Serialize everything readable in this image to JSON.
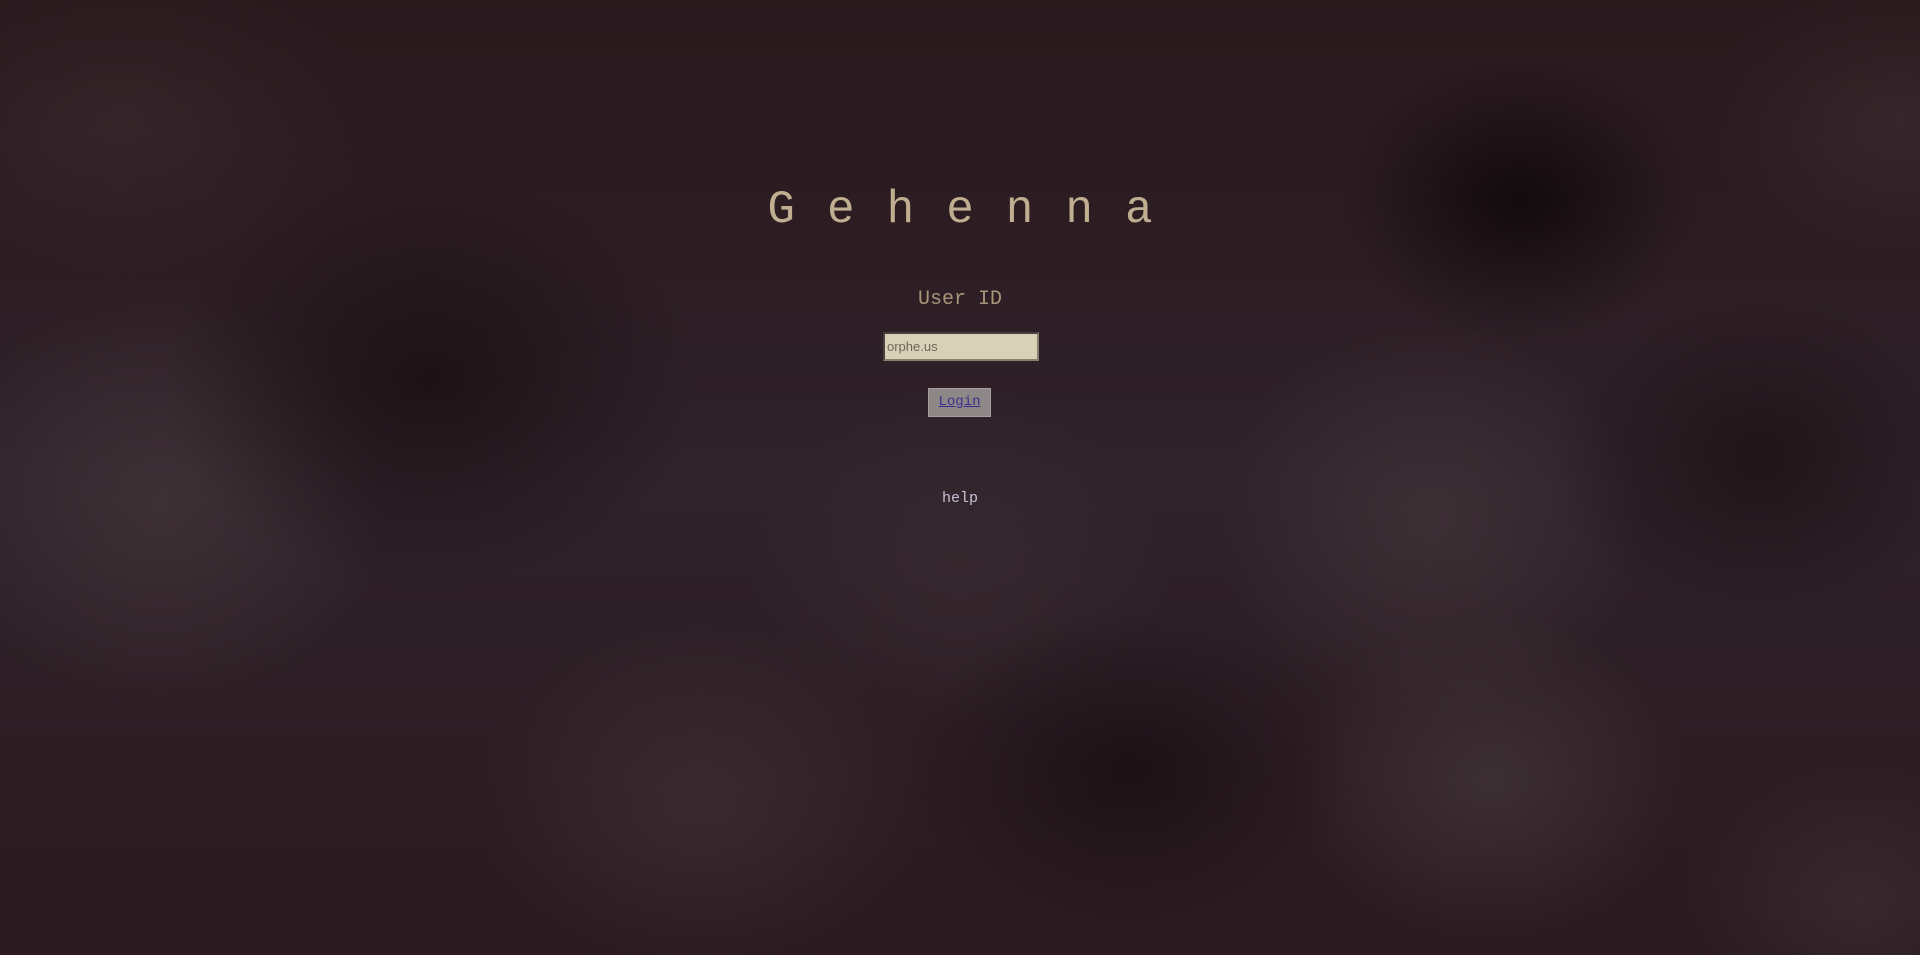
{
  "app": {
    "title": "Gehenna"
  },
  "login": {
    "user_label": "User ID",
    "user_input_placeholder": "orphe.us",
    "user_input_value": "",
    "login_button_label": "Login",
    "help_link_label": "help"
  },
  "colors": {
    "background": "#2c1c20",
    "title_text": "#bfae90",
    "label_text": "#a89478",
    "input_background": "#d9d0b8",
    "button_background": "#8e8787",
    "button_text": "#3b2f8c",
    "help_text": "#c6c0d8"
  }
}
